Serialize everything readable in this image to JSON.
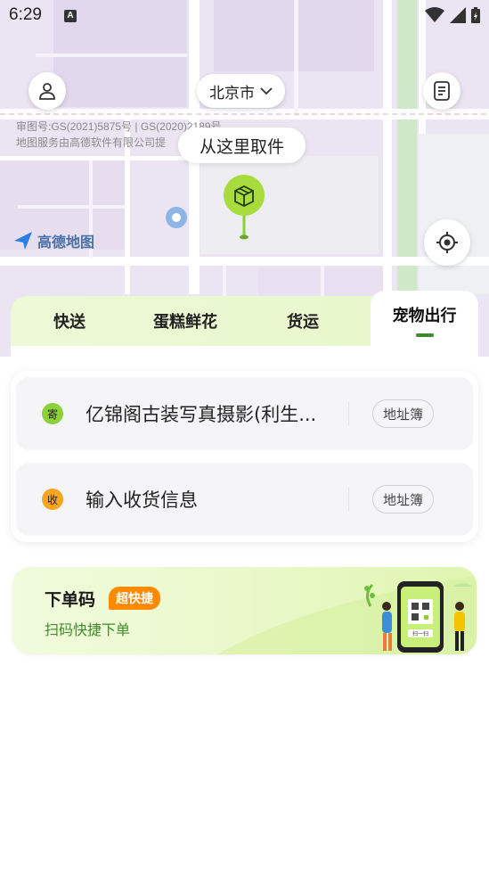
{
  "status_bar": {
    "time": "6:29",
    "notification_letter": "A"
  },
  "map": {
    "city": "北京市",
    "copyright_line1": "审图号:GS(2021)5875号 | GS(2020)2189号",
    "copyright_line2": "地图服务由高德软件有限公司提",
    "pickup_label": "从这里取件",
    "logo_text": "高德地图"
  },
  "tabs": [
    {
      "label": "快送"
    },
    {
      "label": "蛋糕鲜花"
    },
    {
      "label": "货运"
    },
    {
      "label": "宠物出行"
    }
  ],
  "address": {
    "sender_badge": "寄",
    "sender_text": "亿锦阁古装写真摄影(利生...",
    "receiver_badge": "收",
    "receiver_text": "输入收货信息",
    "book_label": "地址簿"
  },
  "banner": {
    "title": "下单码",
    "badge": "超快捷",
    "subtitle": "扫码快捷下单",
    "scan_label": "扫一扫"
  },
  "colors": {
    "accent_green": "#3b8a2b",
    "sender_dot": "#8dd13a",
    "receiver_dot": "#f5a623",
    "badge_orange": "#ff8a00"
  }
}
